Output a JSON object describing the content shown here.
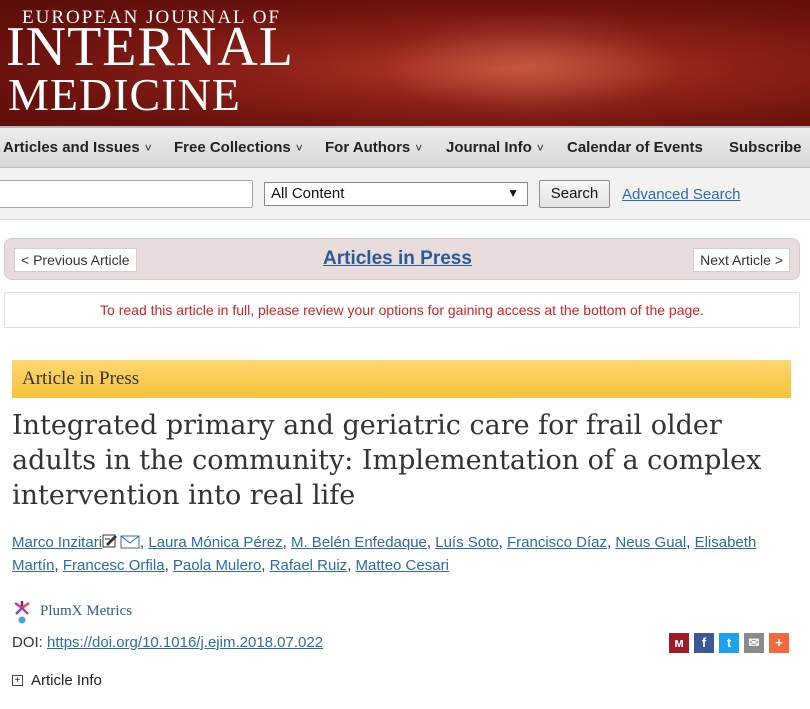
{
  "masthead": {
    "line1": "EUROPEAN JOURNAL OF",
    "line2": "INTERNAL",
    "line3": "MEDICINE"
  },
  "nav": {
    "items": [
      {
        "label": "Articles and Issues",
        "chevron": "˅"
      },
      {
        "label": "Free Collections",
        "chevron": "˅"
      },
      {
        "label": "For Authors",
        "chevron": "˅"
      },
      {
        "label": "Journal Info",
        "chevron": "˅"
      },
      {
        "label": "Calendar of Events",
        "chevron": ""
      },
      {
        "label": "Subscribe",
        "chevron": ""
      }
    ]
  },
  "search": {
    "input_value": "",
    "scope_selected": "All Content",
    "scope_arrow": "▼",
    "button_label": "Search",
    "advanced_label": "Advanced Search"
  },
  "article_nav": {
    "previous": "< Previous Article",
    "center_link": "Articles in Press",
    "next": "Next Article >"
  },
  "notice": "To read this article in full, please review your options for gaining access at the bottom of the page.",
  "article": {
    "status_banner": "Article in Press",
    "title": "Integrated primary and geriatric care for frail older adults in the community: Implementation of a complex intervention into real life",
    "authors": [
      {
        "name": "Marco Inzitari",
        "has_icons": true
      },
      {
        "name": "Laura Mónica Pérez"
      },
      {
        "name": "M. Belén Enfedaque"
      },
      {
        "name": "Luís Soto"
      },
      {
        "name": "Francisco Díaz"
      },
      {
        "name": "Neus Gual"
      },
      {
        "name": "Elisabeth Martín"
      },
      {
        "name": "Francesc Orfila"
      },
      {
        "name": "Paola Mulero"
      },
      {
        "name": "Rafael Ruiz"
      },
      {
        "name": "Matteo Cesari"
      }
    ],
    "plumx_label": "PlumX Metrics",
    "doi_label": "DOI: ",
    "doi_link": "https://doi.org/10.1016/j.ejim.2018.07.022",
    "article_info_label": "Article Info",
    "article_info_toggle": "+"
  },
  "share": [
    {
      "icon": "mendeley-icon",
      "glyph": "ᴍ",
      "color": "#9d1c2c"
    },
    {
      "icon": "facebook-icon",
      "glyph": "f",
      "color": "#3b5998"
    },
    {
      "icon": "twitter-icon",
      "glyph": "t",
      "color": "#1da1f2"
    },
    {
      "icon": "email-icon",
      "glyph": "✉",
      "color": "#8a8a8a"
    },
    {
      "icon": "more-share-icon",
      "glyph": "+",
      "color": "#f26a3c"
    }
  ]
}
